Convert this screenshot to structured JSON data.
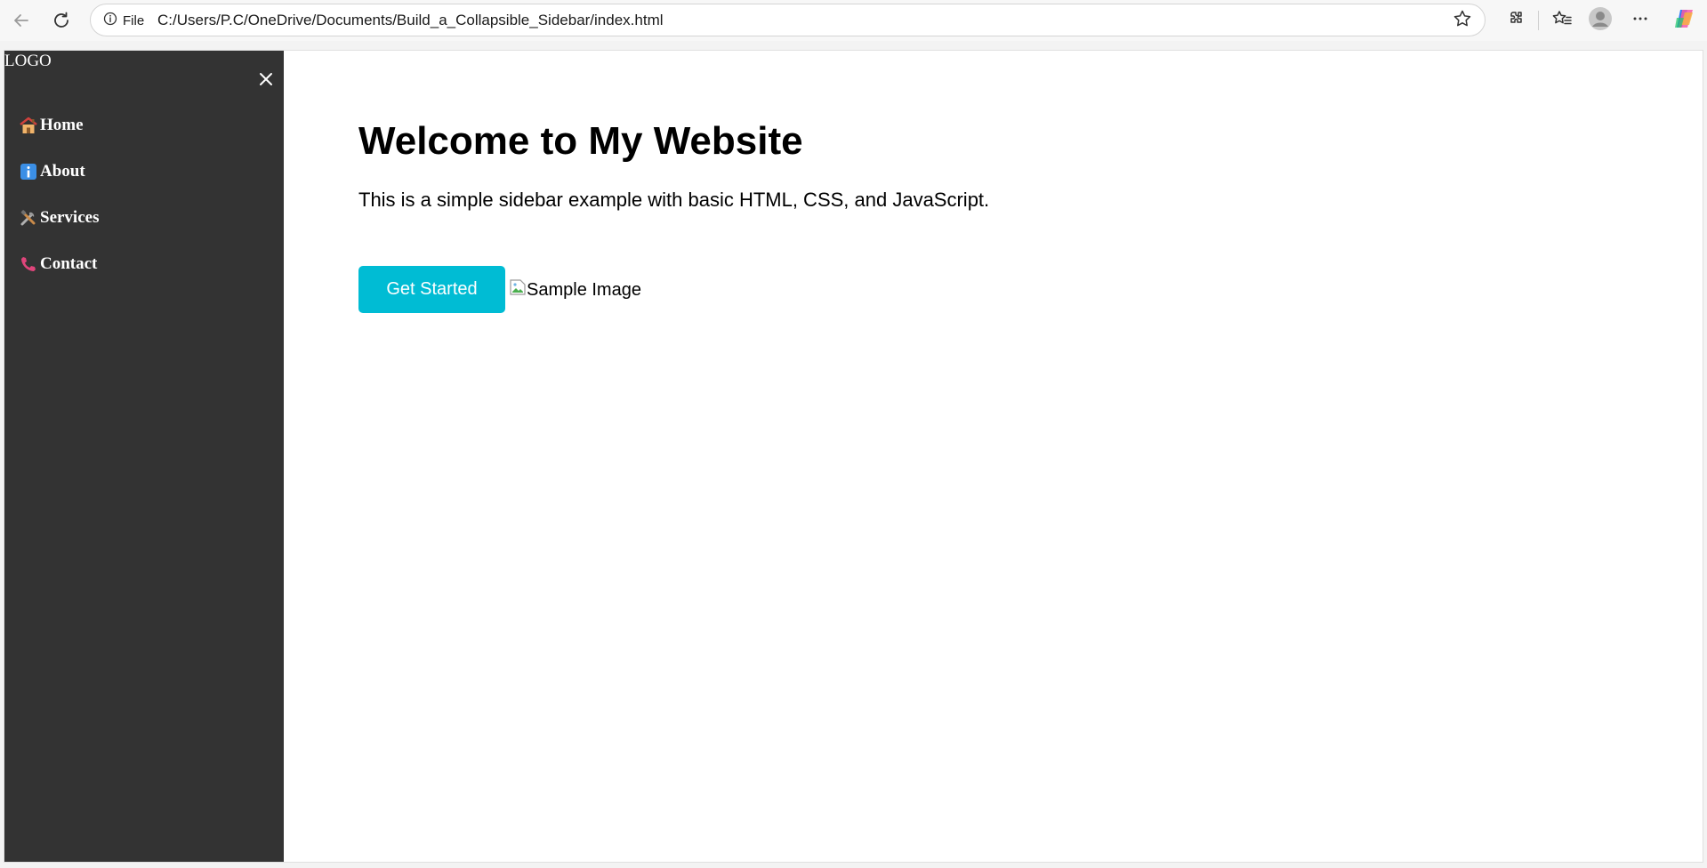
{
  "browser": {
    "site_label": "File",
    "url": "C:/Users/P.C/OneDrive/Documents/Build_a_Collapsible_Sidebar/index.html",
    "icons": [
      "back-icon",
      "refresh-icon",
      "info-icon",
      "star-icon",
      "extensions-icon",
      "favorites-icon",
      "profile-icon",
      "more-icon",
      "copilot-icon"
    ]
  },
  "sidebar": {
    "logo": "LOGO",
    "close_symbol": "×",
    "items": [
      {
        "label": "Home",
        "icon": "house-icon"
      },
      {
        "label": "About",
        "icon": "info-icon"
      },
      {
        "label": "Services",
        "icon": "tools-icon"
      },
      {
        "label": "Contact",
        "icon": "phone-icon"
      }
    ]
  },
  "main": {
    "title": "Welcome to My Website",
    "description": "This is a simple sidebar example with basic HTML, CSS, and JavaScript.",
    "cta_label": "Get Started",
    "image_alt": "Sample Image"
  },
  "colors": {
    "sidebar_bg": "#333333",
    "accent": "#00bcd4"
  }
}
